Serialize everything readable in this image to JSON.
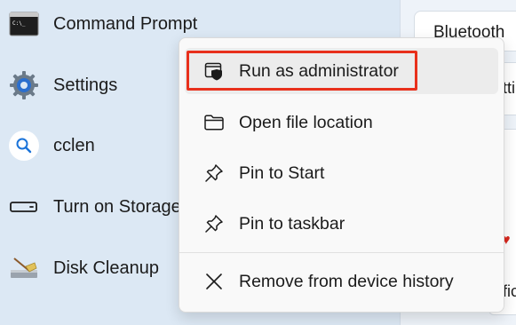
{
  "apps": [
    {
      "label": "Command Prompt",
      "icon": "command-prompt-icon"
    },
    {
      "label": "Settings",
      "icon": "settings-gear-icon"
    },
    {
      "label": "cclen",
      "icon": "search-icon"
    },
    {
      "label": "Turn on Storage",
      "icon": "storage-drive-icon"
    },
    {
      "label": "Disk Cleanup",
      "icon": "disk-cleanup-icon"
    }
  ],
  "right_panel": {
    "bluetooth_label": "Bluetooth",
    "frag_1": "ttir",
    "frag_2": "fic"
  },
  "context_menu": {
    "items": [
      {
        "label": "Run as administrator",
        "icon": "shield-icon"
      },
      {
        "label": "Open file location",
        "icon": "folder-icon"
      },
      {
        "label": "Pin to Start",
        "icon": "pin-icon"
      },
      {
        "label": "Pin to taskbar",
        "icon": "pin-icon"
      },
      {
        "label": "Remove from device history",
        "icon": "close-icon"
      }
    ]
  },
  "colors": {
    "highlight_ring": "#e8301c",
    "left_panel_bg": "#dce8f4",
    "menu_bg": "#f9f9f9"
  }
}
